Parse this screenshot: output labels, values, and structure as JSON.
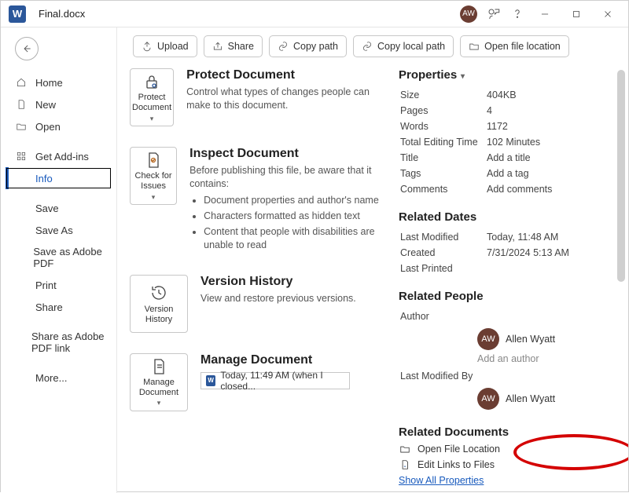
{
  "titlebar": {
    "word_glyph": "W",
    "filename": "Final.docx",
    "avatar_initials": "AW"
  },
  "nav": {
    "home": "Home",
    "new": "New",
    "open": "Open",
    "addins": "Get Add-ins",
    "info": "Info",
    "save": "Save",
    "saveas": "Save As",
    "save_adobe": "Save as Adobe PDF",
    "print": "Print",
    "share": "Share",
    "share_adobe": "Share as Adobe PDF link",
    "more": "More..."
  },
  "toolbar": {
    "upload": "Upload",
    "share": "Share",
    "copy_path": "Copy path",
    "copy_local": "Copy local path",
    "open_loc": "Open file location"
  },
  "sections": {
    "protect": {
      "btn": "Protect Document",
      "title": "Protect Document",
      "body": "Control what types of changes people can make to this document."
    },
    "inspect": {
      "btn": "Check for Issues",
      "title": "Inspect Document",
      "lead": "Before publishing this file, be aware that it contains:",
      "li1": "Document properties and author's name",
      "li2": "Characters formatted as hidden text",
      "li3": "Content that people with disabilities are unable to read"
    },
    "version": {
      "btn": "Version History",
      "title": "Version History",
      "body": "View and restore previous versions."
    },
    "manage": {
      "btn": "Manage Document",
      "title": "Manage Document",
      "entry": "Today, 11:49 AM (when I closed..."
    }
  },
  "props": {
    "header": "Properties",
    "size_k": "Size",
    "size_v": "404KB",
    "pages_k": "Pages",
    "pages_v": "4",
    "words_k": "Words",
    "words_v": "1172",
    "tet_k": "Total Editing Time",
    "tet_v": "102 Minutes",
    "title_k": "Title",
    "title_v": "Add a title",
    "tags_k": "Tags",
    "tags_v": "Add a tag",
    "comments_k": "Comments",
    "comments_v": "Add comments"
  },
  "dates": {
    "header": "Related Dates",
    "mod_k": "Last Modified",
    "mod_v": "Today, 11:48 AM",
    "created_k": "Created",
    "created_v": "7/31/2024 5:13 AM",
    "printed_k": "Last Printed"
  },
  "people": {
    "header": "Related People",
    "author_k": "Author",
    "author_name": "Allen Wyatt",
    "author_init": "AW",
    "add_author": "Add an author",
    "lastmod_k": "Last Modified By",
    "lastmod_name": "Allen Wyatt",
    "lastmod_init": "AW"
  },
  "reldocs": {
    "header": "Related Documents",
    "open_loc": "Open File Location",
    "edit_links": "Edit Links to Files",
    "show_all": "Show All Properties"
  }
}
